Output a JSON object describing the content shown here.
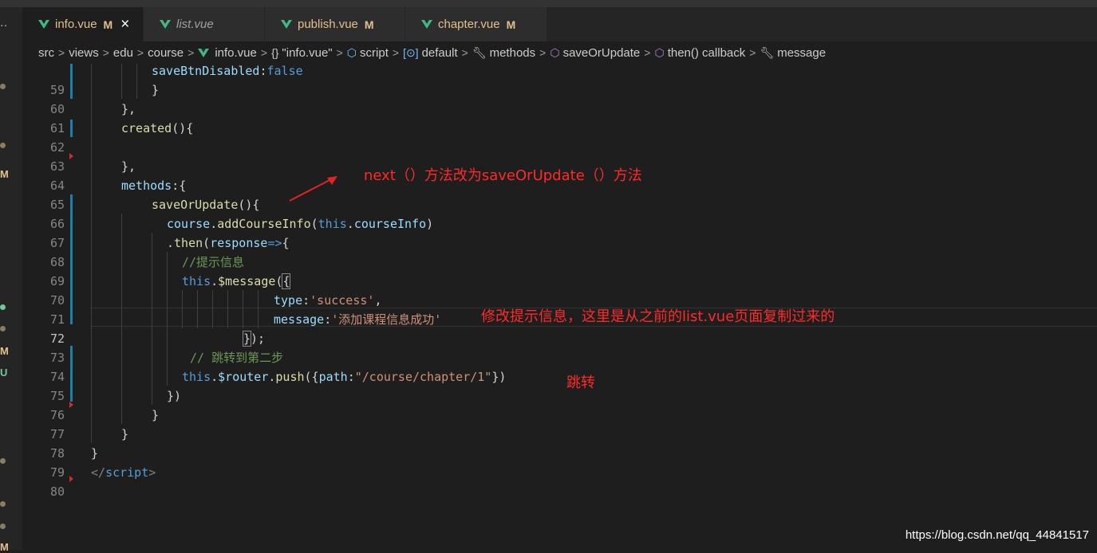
{
  "tabs": [
    {
      "name": "info.vue",
      "status": "M",
      "active": true
    },
    {
      "name": "list.vue",
      "status": "",
      "active": false
    },
    {
      "name": "publish.vue",
      "status": "M",
      "active": false
    },
    {
      "name": "chapter.vue",
      "status": "M",
      "active": false
    }
  ],
  "left_gutter": {
    "menu": "··",
    "marks": [
      "M",
      "M",
      "U",
      "M"
    ]
  },
  "breadcrumb": {
    "path": [
      "src",
      "views",
      "edu",
      "course"
    ],
    "file": "info.vue",
    "symbols": [
      "\"info.vue\"",
      "script",
      "default",
      "methods",
      "saveOrUpdate",
      "then() callback",
      "message"
    ]
  },
  "line_numbers": [
    "59",
    "60",
    "61",
    "62",
    "63",
    "64",
    "65",
    "66",
    "67",
    "68",
    "69",
    "70",
    "71",
    "72",
    "73",
    "74",
    "75",
    "76",
    "77",
    "78",
    "79",
    "80"
  ],
  "code": {
    "l59_prop": "saveBtnDisabled",
    "l59_colon": ":",
    "l59_val": "false",
    "l60": "}",
    "l61": "},",
    "l62_fn": "created",
    "l62_rest": "(){",
    "l64": "},",
    "l65_prop": "methods",
    "l65_rest": ":{",
    "l66_fn": "saveOrUpdate",
    "l66_rest": "(){",
    "l67_obj": "course",
    "l67_dot": ".",
    "l67_fn": "addCourseInfo",
    "l67_p": "(",
    "l67_this": "this",
    "l67_dot2": ".",
    "l67_prop": "courseInfo",
    "l67_end": ")",
    "l68_dot": ".",
    "l68_fn": "then",
    "l68_p": "(",
    "l68_param": "response",
    "l68_arrow": "=>",
    "l68_brace": "{",
    "l69_comment": "//提示信息",
    "l70_this": "this",
    "l70_dot": ".",
    "l70_fn": "$message",
    "l70_p": "(",
    "l70_brace": "{",
    "l71_prop": "type",
    "l71_colon": ":",
    "l71_str": "'success'",
    "l71_comma": ",",
    "l72_prop": "message",
    "l72_colon": ":",
    "l72_str": "'添加课程信息成功'",
    "l73_brace": "}",
    "l73_rest": ");",
    "l74_comment": "// 跳转到第二步",
    "l75_this": "this",
    "l75_dot": ".",
    "l75_router": "$router",
    "l75_dot2": ".",
    "l75_fn": "push",
    "l75_p": "({",
    "l75_key": "path",
    "l75_colon": ":",
    "l75_str": "\"/course/chapter/1\"",
    "l75_end": "})",
    "l76": "})",
    "l77": "}",
    "l78": "}",
    "l79": "}",
    "l80_open": "</",
    "l80_tag": "script",
    "l80_close": ">"
  },
  "annotations": {
    "a1": "next（）方法改为saveOrUpdate（）方法",
    "a2": "修改提示信息，这里是从之前的list.vue页面复制过来的",
    "a3": "跳转"
  },
  "watermark": "https://blog.csdn.net/qq_44841517",
  "colors": {
    "annotation": "#ff2a2a",
    "vue_green": "#41b883",
    "modified": "#e2c08d"
  }
}
